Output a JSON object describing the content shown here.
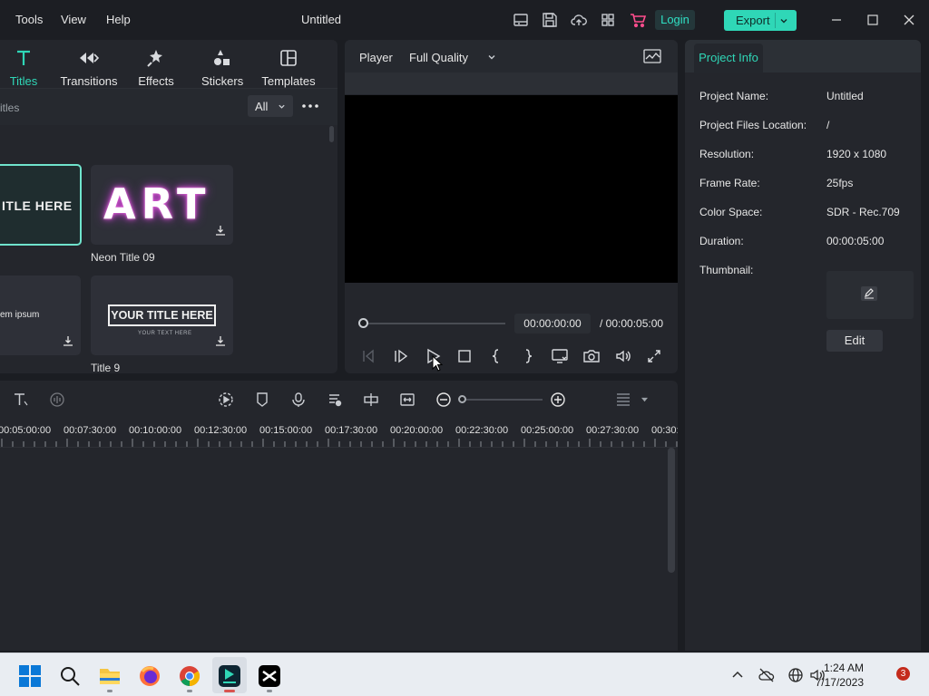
{
  "menu": [
    "Tools",
    "View",
    "Help"
  ],
  "app_title": "Untitled",
  "login_label": "Login",
  "export_label": "Export",
  "asset_tabs": [
    {
      "label": "Titles",
      "icon": "title-t-icon",
      "active": true
    },
    {
      "label": "Transitions",
      "icon": "transitions-icon"
    },
    {
      "label": "Effects",
      "icon": "effects-icon"
    },
    {
      "label": "Stickers",
      "icon": "stickers-icon"
    },
    {
      "label": "Templates",
      "icon": "templates-icon"
    }
  ],
  "filter": {
    "search_text": "itles",
    "dropdown_value": "All"
  },
  "title_cards": [
    {
      "preview_text": "ITLE HERE",
      "label": ""
    },
    {
      "preview_text": "ART",
      "label": "Neon Title 09"
    },
    {
      "preview_text": "em ipsum",
      "label": ""
    },
    {
      "preview_text": "YOUR TITLE HERE",
      "preview_sub": "YOUR TEXT HERE",
      "label": "Title 9"
    }
  ],
  "player": {
    "label": "Player",
    "quality": "Full Quality",
    "current_time": "00:00:00:00",
    "total_time": "/  00:00:05:00"
  },
  "project_info": {
    "tab_label": "Project Info",
    "rows": [
      {
        "label": "Project Name:",
        "value": "Untitled"
      },
      {
        "label": "Project Files Location:",
        "value": "/"
      },
      {
        "label": "Resolution:",
        "value": "1920 x 1080"
      },
      {
        "label": "Frame Rate:",
        "value": "25fps"
      },
      {
        "label": "Color Space:",
        "value": "SDR - Rec.709"
      },
      {
        "label": "Duration:",
        "value": "00:00:05:00"
      }
    ],
    "thumbnail_label": "Thumbnail:",
    "edit_label": "Edit"
  },
  "timeline": {
    "ruler_labels": [
      "00:05:00:00",
      "00:07:30:00",
      "00:10:00:00",
      "00:12:30:00",
      "00:15:00:00",
      "00:17:30:00",
      "00:20:00:00",
      "00:22:30:00",
      "00:25:00:00",
      "00:27:30:00",
      "00:30:"
    ]
  },
  "taskbar": {
    "time": "1:24 AM",
    "date": "7/17/2023",
    "notification_count": "3"
  },
  "colors": {
    "accent": "#2fd7b7",
    "background": "#1b1d22",
    "panel": "#24262c"
  }
}
